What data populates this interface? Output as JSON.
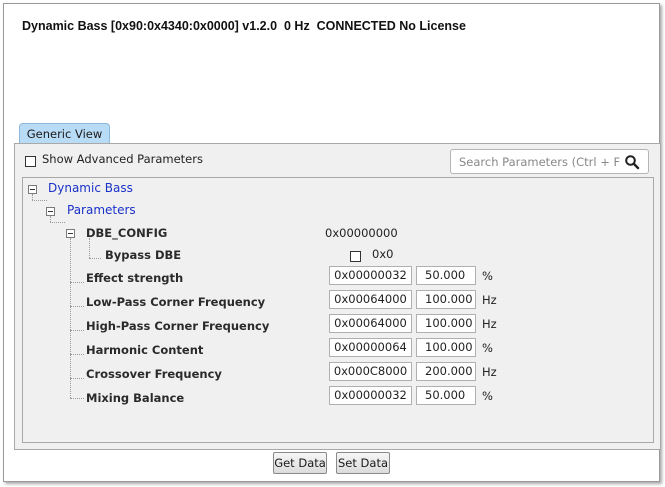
{
  "window": {
    "title": "Dynamic Bass [0x90:0x4340:0x0000] v1.2.0  0 Hz  CONNECTED No License"
  },
  "tabs": [
    {
      "label": "Generic View",
      "active": true
    }
  ],
  "options": {
    "show_advanced_label": "Show Advanced Parameters",
    "show_advanced_checked": false
  },
  "search": {
    "placeholder": "Search Parameters (Ctrl + F)",
    "value": ""
  },
  "tree": {
    "root_label": "Dynamic Bass",
    "group_label": "Parameters",
    "config": {
      "label": "DBE_CONFIG",
      "value": "0x00000000",
      "bypass": {
        "label": "Bypass DBE",
        "checked": false,
        "value": "0x0"
      }
    },
    "params": [
      {
        "label": "Effect strength",
        "hex": "0x00000032",
        "value": "50.000",
        "unit": "%"
      },
      {
        "label": "Low-Pass Corner Frequency",
        "hex": "0x00064000",
        "value": "100.000",
        "unit": "Hz"
      },
      {
        "label": "High-Pass Corner Frequency",
        "hex": "0x00064000",
        "value": "100.000",
        "unit": "Hz"
      },
      {
        "label": "Harmonic Content",
        "hex": "0x00000064",
        "value": "100.000",
        "unit": "%"
      },
      {
        "label": "Crossover Frequency",
        "hex": "0x000C8000",
        "value": "200.000",
        "unit": "Hz"
      },
      {
        "label": "Mixing Balance",
        "hex": "0x00000032",
        "value": "50.000",
        "unit": "%"
      }
    ]
  },
  "buttons": {
    "get_data": "Get Data",
    "set_data": "Set Data"
  },
  "colors": {
    "tab_bg": "#b9dcf6",
    "tree_link": "#1a31c8",
    "panel_bg": "#f0f0f0"
  },
  "icons": {
    "search": "search-icon",
    "collapse": "collapse-icon"
  }
}
